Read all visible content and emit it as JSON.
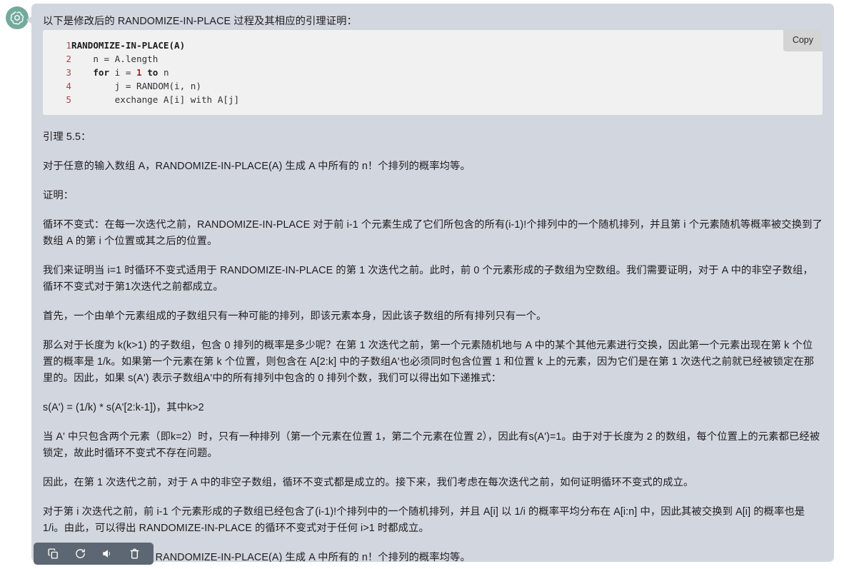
{
  "avatar": {
    "name": "chatgpt-logo"
  },
  "message": {
    "intro": "以下是修改后的 RANDOMIZE-IN-PLACE 过程及其相应的引理证明：",
    "code": {
      "copy_label": "Copy",
      "lines": [
        {
          "n": "1",
          "tokens": [
            {
              "t": "RANDOMIZE-IN-PLACE(A)",
              "c": "kw"
            }
          ]
        },
        {
          "n": "2",
          "tokens": [
            {
              "t": "    n = A.length",
              "c": ""
            }
          ]
        },
        {
          "n": "3",
          "tokens": [
            {
              "t": "    ",
              "c": ""
            },
            {
              "t": "for",
              "c": "kw"
            },
            {
              "t": " i = ",
              "c": ""
            },
            {
              "t": "1",
              "c": "num"
            },
            {
              "t": " ",
              "c": ""
            },
            {
              "t": "to",
              "c": "kw"
            },
            {
              "t": " n",
              "c": ""
            }
          ]
        },
        {
          "n": "4",
          "tokens": [
            {
              "t": "        j = RANDOM(i, n)",
              "c": ""
            }
          ]
        },
        {
          "n": "5",
          "tokens": [
            {
              "t": "        exchange A[i] with A[j]",
              "c": ""
            }
          ]
        }
      ]
    },
    "paragraphs": [
      "引理 5.5：",
      "对于任意的输入数组 A，RANDOMIZE-IN-PLACE(A) 生成 A 中所有的 n！个排列的概率均等。",
      "证明：",
      "循环不变式：在每一次迭代之前，RANDOMIZE-IN-PLACE 对于前 i-1 个元素生成了它们所包含的所有(i-1)!个排列中的一个随机排列，并且第 i 个元素随机等概率被交换到了数组 A 的第 i 个位置或其之后的位置。",
      "我们来证明当 i=1 时循环不变式适用于 RANDOMIZE-IN-PLACE 的第 1 次迭代之前。此时，前 0 个元素形成的子数组为空数组。我们需要证明，对于 A 中的非空子数组，循环不变式对于第1次迭代之前都成立。",
      "首先，一个由单个元素组成的子数组只有一种可能的排列，即该元素本身，因此该子数组的所有排列只有一个。",
      "那么对于长度为 k(k>1) 的子数组，包含 0 排列的概率是多少呢？在第 1 次迭代之前，第一个元素随机地与 A 中的某个其他元素进行交换，因此第一个元素出现在第 k 个位置的概率是 1/k。如果第一个元素在第 k 个位置，则包含在 A[2:k] 中的子数组A'也必须同时包含位置 1 和位置 k 上的元素，因为它们是在第 1 次迭代之前就已经被锁定在那里的。因此，如果 s(A') 表示子数组A'中的所有排列中包含的 0 排列个数，我们可以得出如下递推式：",
      "s(A') = (1/k) * s(A'[2:k-1])，其中k>2",
      "当 A' 中只包含两个元素（即k=2）时，只有一种排列（第一个元素在位置 1，第二个元素在位置 2），因此有s(A')=1。由于对于长度为 2 的数组，每个位置上的元素都已经被锁定，故此时循环不变式不存在问题。",
      "因此，在第 1 次迭代之前，对于 A 中的非空子数组，循环不变式都是成立的。接下来，我们考虑在每次迭代之前，如何证明循环不变式的成立。",
      "对于第 i 次迭代之前，前 i-1 个元素形成的子数组已经包含了(i-1)!个排列中的一个随机排列，并且 A[i] 以 1/i 的概率平均分布在 A[i:n] 中，因此其被交换到 A[i] 的概率也是 1/i。由此，可以得出 RANDOMIZE-IN-PLACE 的循环不变式对于任何 i>1 时都成立。",
      "因此，对于输入数组 A，RANDOMIZE-IN-PLACE(A) 生成 A 中所有的 n！个排列的概率均等。"
    ]
  },
  "actions": [
    {
      "name": "copy-icon",
      "label": "Copy"
    },
    {
      "name": "regenerate-icon",
      "label": "Regenerate"
    },
    {
      "name": "speak-icon",
      "label": "Read aloud"
    },
    {
      "name": "delete-icon",
      "label": "Delete"
    }
  ],
  "colors": {
    "bubble_bg": "#d2d6de",
    "code_bg": "#f1f1f1",
    "copy_btn_bg": "#d4d4d4",
    "linenumber": "#a14b4b",
    "number_literal": "#9e2b2b",
    "avatar_bg": "#74aa9c",
    "actionbar_bg": "#5d6773",
    "page_bg": "#ffffff"
  }
}
